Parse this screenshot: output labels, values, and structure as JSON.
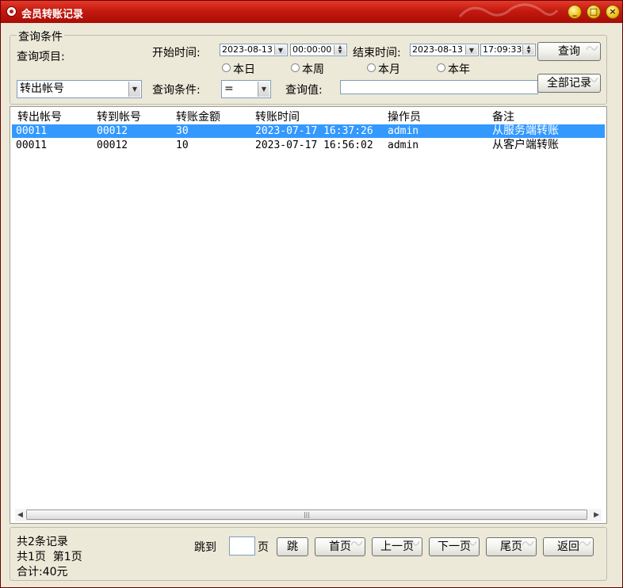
{
  "window": {
    "title": "会员转账记录"
  },
  "titlebar_buttons": {
    "minimize": "_",
    "maximize": "□",
    "close": "×"
  },
  "query": {
    "group_label": "查询条件",
    "item_label": "查询项目:",
    "start_label": "开始时间:",
    "start_date": "2023-08-13",
    "start_time": "00:00:00",
    "end_label": "结束时间:",
    "end_date": "2023-08-13",
    "end_time": "17:09:33",
    "query_button": "查询",
    "all_records_button": "全部记录",
    "radios": [
      "本日",
      "本周",
      "本月",
      "本年"
    ],
    "item_value": "转出帐号",
    "condition_label": "查询条件:",
    "condition_value": "=",
    "value_label": "查询值:",
    "value_input": ""
  },
  "table": {
    "columns": [
      "转出帐号",
      "转到帐号",
      "转账金额",
      "转账时间",
      "操作员",
      "备注"
    ],
    "rows": [
      [
        "00011",
        "00012",
        "30",
        "2023-07-17 16:37:26",
        "admin",
        "从服务端转账"
      ],
      [
        "00011",
        "00012",
        "10",
        "2023-07-17 16:56:02",
        "admin",
        "从客户端转账"
      ]
    ],
    "selected_row": 0
  },
  "footer": {
    "total_records": "共2条记录",
    "pages": "共1页  第1页",
    "sum": "合计:40元",
    "jump_label": "跳到",
    "page_unit": "页",
    "jump_button": "跳",
    "first_button": "首页",
    "prev_button": "上一页",
    "next_button": "下一页",
    "last_button": "尾页",
    "back_button": "返回"
  },
  "colors": {
    "title_red": "#c41a10",
    "selection_blue": "#3399ff",
    "window_bg": "#ece9d8"
  },
  "icons": [
    "app-icon",
    "dropdown-arrow-icon",
    "spinner-icon",
    "scroll-left-icon",
    "scroll-right-icon",
    "swirl-decoration-icon"
  ]
}
